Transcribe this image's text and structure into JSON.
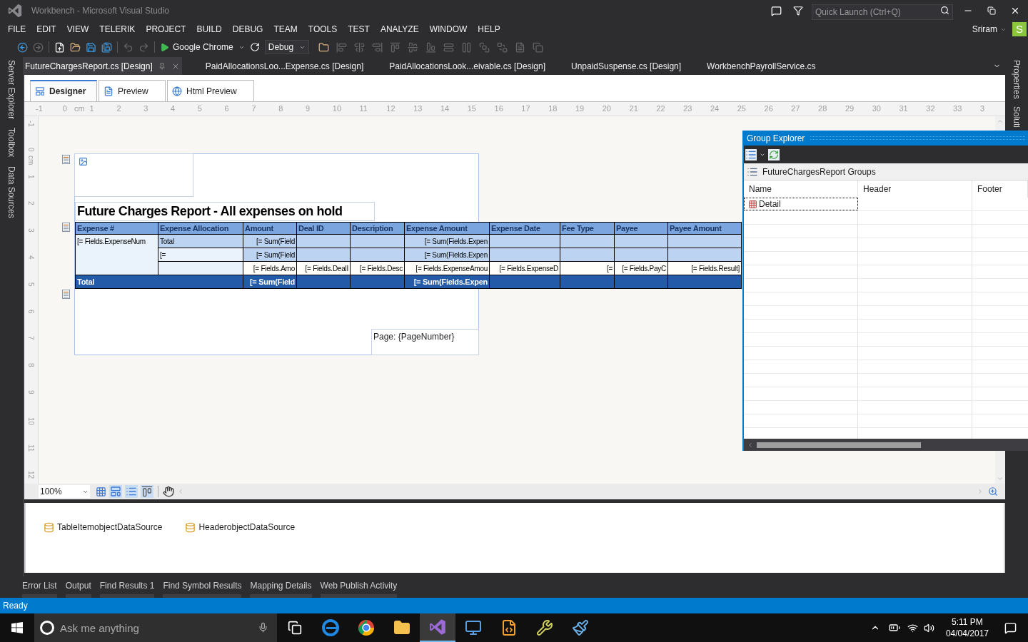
{
  "window": {
    "title": "Workbench - Microsoft Visual Studio"
  },
  "quick_launch": {
    "placeholder": "Quick Launch (Ctrl+Q)"
  },
  "account": {
    "name": "Sriram",
    "initial": "S"
  },
  "menu": [
    "FILE",
    "EDIT",
    "VIEW",
    "TELERIK",
    "PROJECT",
    "BUILD",
    "DEBUG",
    "TEAM",
    "TOOLS",
    "TEST",
    "ANALYZE",
    "WINDOW",
    "HELP"
  ],
  "toolbar": {
    "run_target": "Google Chrome",
    "configuration": "Debug"
  },
  "doc_tabs": [
    {
      "label": "FutureChargesReport.cs [Design]",
      "selected": true
    },
    {
      "label": "PaidAllocationsLoo...Expense.cs [Design]",
      "selected": false
    },
    {
      "label": "PaidAllocationsLook...eivable.cs [Design]",
      "selected": false
    },
    {
      "label": "UnpaidSuspense.cs [Design]",
      "selected": false
    },
    {
      "label": "WorkbenchPayrollService.cs",
      "selected": false
    }
  ],
  "left_rail": [
    "Server Explorer",
    "Toolbox",
    "Data Sources"
  ],
  "right_rail": [
    "Properties",
    "Soluti"
  ],
  "designer_tabs": [
    {
      "label": "Designer",
      "selected": true
    },
    {
      "label": "Preview",
      "selected": false
    },
    {
      "label": "Html Preview",
      "selected": false
    }
  ],
  "ruler": {
    "ticks_before": [
      "-1",
      "0"
    ],
    "unit": "cm",
    "ticks": [
      "1",
      "2",
      "3",
      "4",
      "5",
      "6",
      "7",
      "8",
      "9",
      "10",
      "11",
      "12",
      "13",
      "14",
      "15",
      "16",
      "17",
      "18",
      "19",
      "20",
      "21",
      "22",
      "23",
      "24",
      "25",
      "26",
      "27",
      "28",
      "29",
      "30",
      "31",
      "32",
      "33",
      "3"
    ]
  },
  "vertical_ruler": {
    "ticks_before": [
      "-1",
      "0"
    ],
    "unit": "cm",
    "ticks": [
      "1",
      "2",
      "3",
      "4",
      "5",
      "6",
      "7",
      "8",
      "9",
      "10",
      "11",
      "12"
    ]
  },
  "report": {
    "title": "Future Charges Report - All expenses on hold",
    "page_number": "Page: {PageNumber}",
    "columns": [
      "Expense #",
      "Expense Allocation",
      "Amount",
      "Deal ID",
      "Description",
      "Expense Amount",
      "Expense Date",
      "Fee Type",
      "Payee",
      "Payee Amount"
    ],
    "rows": [
      {
        "kind": "group",
        "cells": [
          "[= Fields.ExpenseNum",
          "Total",
          "[= Sum(Field",
          "",
          "",
          "[= Sum(Fields.Expen",
          "",
          "",
          "",
          ""
        ]
      },
      {
        "kind": "subgroup",
        "cells": [
          "",
          "[=",
          "[= Sum(Field",
          "",
          "",
          "[= Sum(Fields.Expen",
          "",
          "",
          "",
          ""
        ]
      },
      {
        "kind": "detail",
        "cells": [
          "",
          "",
          "[= Fields.Amo",
          "[= Fields.DealI",
          "[= Fields.Desc",
          "[= Fields.ExpenseAmou",
          "[= Fields.ExpenseD",
          "[=",
          "[= Fields.PayC",
          "[= Fields.Result]"
        ]
      },
      {
        "kind": "total",
        "cells": [
          "Total",
          "",
          "[= Sum(Field",
          "",
          "",
          "[= Sum(Fields.Expen",
          "",
          "",
          "",
          ""
        ]
      }
    ]
  },
  "zoom": {
    "value": "100%"
  },
  "data_sources": [
    "TableItemobjectDataSource",
    "HeaderobjectDataSource"
  ],
  "group_explorer": {
    "title": "Group Explorer",
    "heading": "FutureChargesReport Groups",
    "columns": [
      "Name",
      "Header",
      "Footer"
    ],
    "rows": [
      {
        "name": "Detail",
        "selected": true
      }
    ]
  },
  "bottom_tabs": [
    "Error List",
    "Output",
    "Find Results 1",
    "Find Symbol Results",
    "Mapping Details",
    "Web Publish Activity"
  ],
  "status_bar": {
    "text": "Ready"
  },
  "taskbar": {
    "search_placeholder": "Ask me anything",
    "time": "5:11 PM",
    "date": "04/04/2017"
  }
}
